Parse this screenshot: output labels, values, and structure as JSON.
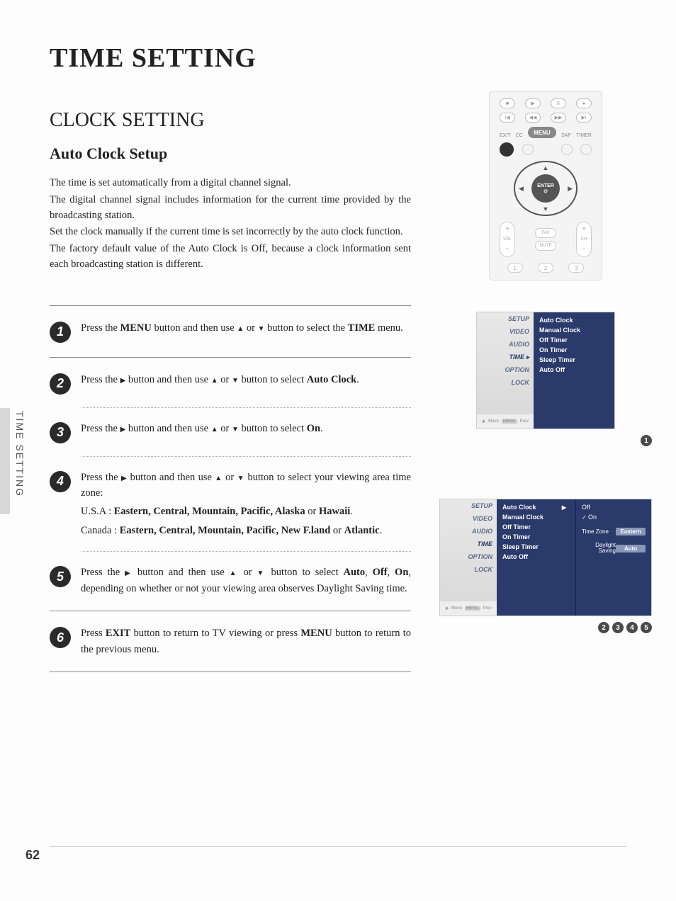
{
  "title": "TIME SETTING",
  "side_tab": "TIME SETTING",
  "page_number": "62",
  "section": {
    "heading": "CLOCK SETTING",
    "subheading": "Auto Clock Setup",
    "intro": [
      "The time is set automatically from a digital channel signal.",
      "The digital channel signal includes information for the current time provided by the broadcasting station.",
      "Set the clock manually if the current time is set incorrectly by the auto clock function.",
      "The factory default value of the Auto Clock is Off, because a clock information sent each broadcasting station is different."
    ]
  },
  "steps": {
    "s1a": "Press the ",
    "s1_menu": "MENU",
    "s1b": " button and then use ",
    "s1c": " button to select the ",
    "s1_time": "TIME",
    "s1d": " menu.",
    "s2a": "Press the ",
    "s2b": " button and then use ",
    "s2c": " button to select ",
    "s2_auto": "Auto Clock",
    "s3a": "Press the ",
    "s3b": " button and then use ",
    "s3c": " button to select ",
    "s3_on": "On",
    "s4a": "Press the ",
    "s4b": " button and then use ",
    "s4c": " button to select your viewing area time zone:",
    "s4_usa_label": "U.S.A : ",
    "s4_usa": "Eastern, Central, Mountain, Pacific, Alaska",
    "s4_usa_or": " or ",
    "s4_usa_last": "Hawaii",
    "s4_can_label": "Canada : ",
    "s4_can": "Eastern, Central, Mountain, Pacific, New F.land",
    "s4_can_or": " or ",
    "s4_can_last": "Atlantic",
    "s5a": "Press the ",
    "s5b": " button and then use ",
    "s5c": " button to select ",
    "s5_auto": "Auto",
    "s5_off": "Off",
    "s5_on": "On",
    "s5d": ", depending on whether or not your viewing area observes Daylight Saving time.",
    "s6a": "Press ",
    "s6_exit": "EXIT",
    "s6b": " button to return to TV viewing or press ",
    "s6_menu": "MENU",
    "s6c": " button to return to the previous menu."
  },
  "step_nums": [
    "1",
    "2",
    "3",
    "4",
    "5",
    "6"
  ],
  "or_text": " or ",
  "period": ".",
  "comma_sp": ", ",
  "remote": {
    "labels": {
      "cc": "CC",
      "sap": "SAP",
      "exit": "EXIT",
      "timer": "TIMER",
      "vol": "VOL",
      "ch": "CH"
    },
    "menu": "MENU",
    "enter": "ENTER",
    "fav": "FAV",
    "mute": "MUTE",
    "plus": "+",
    "minus": "−",
    "nums": [
      "1",
      "2",
      "3"
    ]
  },
  "osd1": {
    "left": [
      "SETUP",
      "VIDEO",
      "AUDIO",
      "TIME ▸",
      "OPTION",
      "LOCK"
    ],
    "footer": {
      "move": "Move",
      "prev": "Prev"
    },
    "right": [
      "Auto Clock",
      "Manual Clock",
      "Off Timer",
      "On Timer",
      "Sleep Timer",
      "Auto Off"
    ],
    "dot": "1"
  },
  "osd2": {
    "left": [
      "SETUP",
      "VIDEO",
      "AUDIO",
      "TIME",
      "OPTION",
      "LOCK"
    ],
    "footer": {
      "move": "Move",
      "prev": "Prev"
    },
    "mid": [
      {
        "label": "Auto Clock",
        "chev": "▶"
      },
      {
        "label": "Manual Clock"
      },
      {
        "label": "Off Timer"
      },
      {
        "label": "On Timer"
      },
      {
        "label": "Sleep Timer"
      },
      {
        "label": "Auto Off"
      }
    ],
    "sub": {
      "off": "Off",
      "on": "On",
      "tz_label": "Time Zone",
      "tz_value": "Eastern",
      "ds_label": "Daylight Saving",
      "ds_value": "Auto"
    },
    "dots": [
      "2",
      "3",
      "4",
      "5"
    ]
  }
}
